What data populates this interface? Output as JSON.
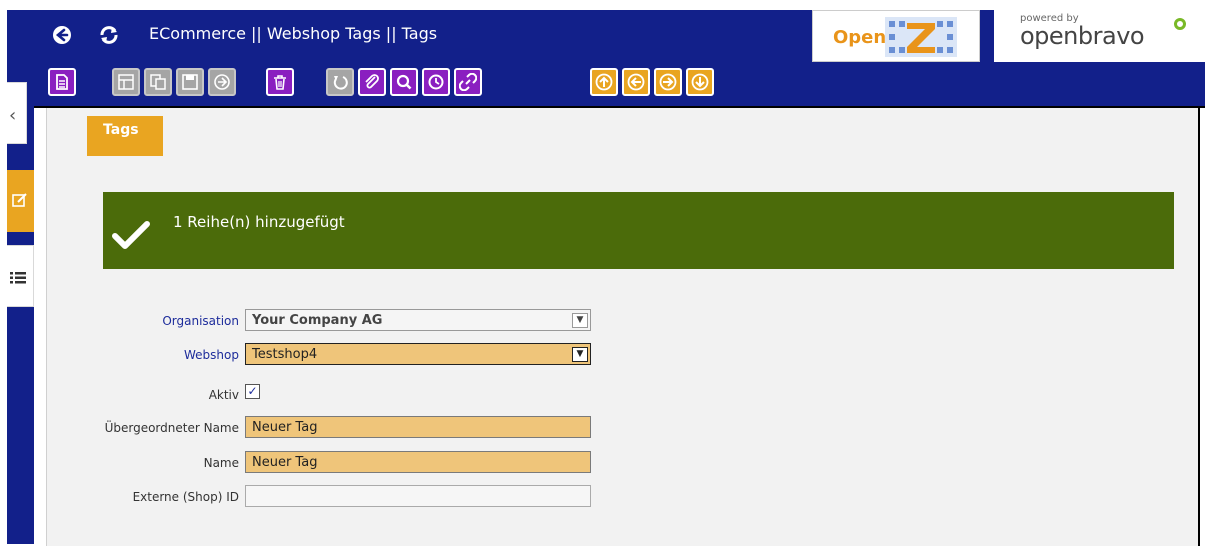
{
  "window": {
    "title": "ECommerce || Webshop Tags || Tags",
    "back_icon": "back-arrow-icon",
    "refresh_icon": "refresh-icon"
  },
  "logos": {
    "openz_text": "Open",
    "openz_letter": "Z",
    "powered_by": "powered by",
    "openbravo": "openbravo"
  },
  "side_tabs": {
    "collapse_glyph": "‹"
  },
  "tab": {
    "label": "Tags"
  },
  "message": {
    "text": "1 Reihe(n) hinzugefügt"
  },
  "form": {
    "organisation": {
      "label": "Organisation",
      "value": "Your Company AG"
    },
    "webshop": {
      "label": "Webshop",
      "value": "Testshop4"
    },
    "aktiv": {
      "label": "Aktiv",
      "checked": true,
      "glyph": "✓"
    },
    "parent_name": {
      "label": "Übergeordneter Name",
      "value": "Neuer Tag"
    },
    "name": {
      "label": "Name",
      "value": "Neuer Tag"
    },
    "external_id": {
      "label": "Externe (Shop) ID",
      "value": ""
    }
  },
  "colors": {
    "header_blue": "#12208a",
    "accent_orange": "#e9a521",
    "toolbar_purple": "#8a1fc0",
    "success_green": "#4b6b0a",
    "required_field": "#efc57a"
  }
}
